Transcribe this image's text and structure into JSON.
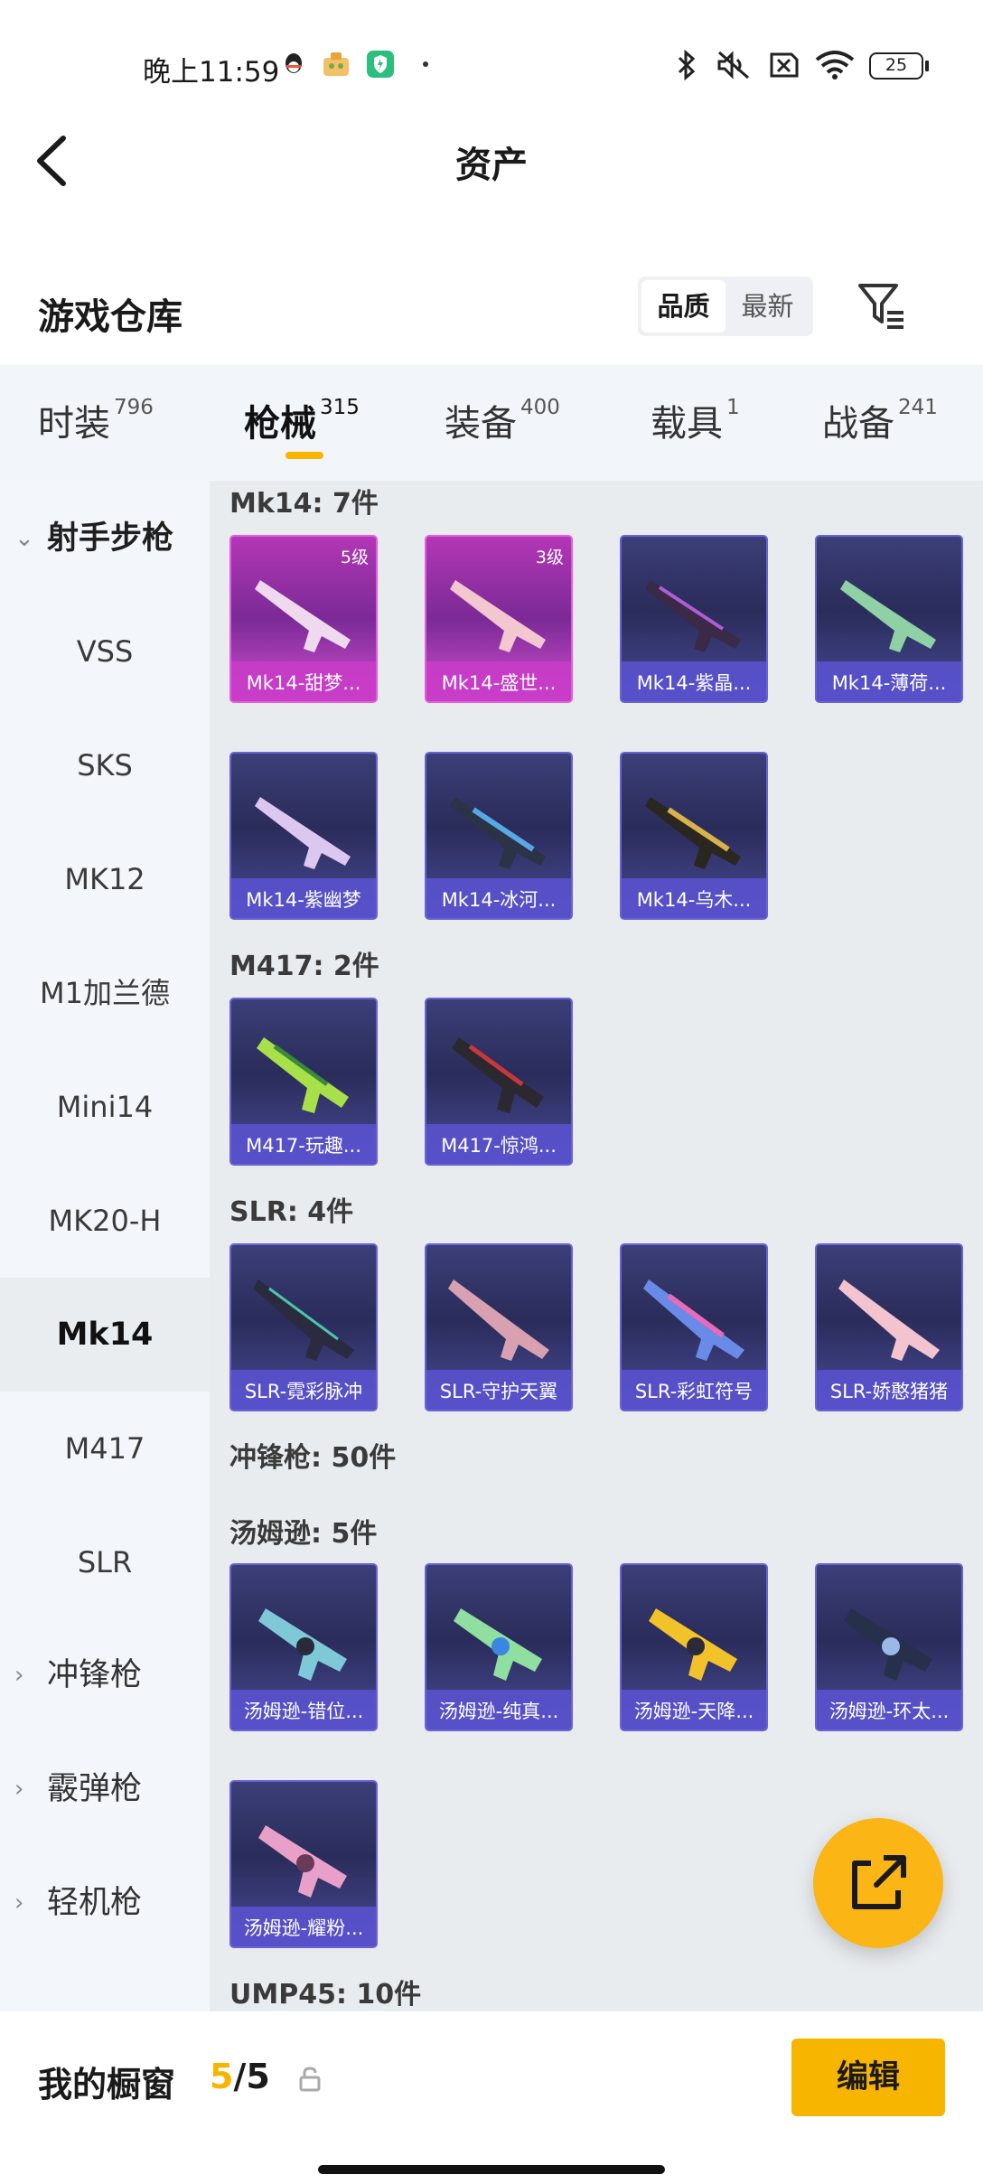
{
  "status_bar": {
    "time": "晚上11:59",
    "battery": "25",
    "icons": [
      "qq-icon",
      "app-icon",
      "security-icon",
      "bluetooth-icon",
      "mute-icon",
      "sim-icon",
      "wifi-icon"
    ]
  },
  "header": {
    "title": "资产",
    "back_icon": "chevron-left-icon"
  },
  "section": {
    "title": "游戏仓库",
    "sort": [
      "品质",
      "最新"
    ],
    "sort_active": "品质",
    "filter_icon": "filter-icon"
  },
  "tabs": [
    {
      "label": "时装",
      "count": "796"
    },
    {
      "label": "枪械",
      "count": "315"
    },
    {
      "label": "装备",
      "count": "400"
    },
    {
      "label": "载具",
      "count": "1"
    },
    {
      "label": "战备",
      "count": "241"
    }
  ],
  "active_tab": "枪械",
  "sidebar": {
    "group_expanded": "射手步枪",
    "items": [
      "VSS",
      "SKS",
      "MK12",
      "M1加兰德",
      "Mini14",
      "MK20-H",
      "Mk14",
      "M417",
      "SLR"
    ],
    "selected": "Mk14",
    "collapsed_groups": [
      "冲锋枪",
      "霰弹枪",
      "轻机枪"
    ]
  },
  "groups": [
    {
      "title": "Mk14: 7件",
      "items": [
        {
          "name": "Mk14-甜梦...",
          "level": "5级",
          "rarity": "pink"
        },
        {
          "name": "Mk14-盛世...",
          "level": "3级",
          "rarity": "pink"
        },
        {
          "name": "Mk14-紫晶...",
          "level": "",
          "rarity": "purple"
        },
        {
          "name": "Mk14-薄荷...",
          "level": "",
          "rarity": "purple"
        },
        {
          "name": "Mk14-紫幽梦",
          "level": "",
          "rarity": "purple"
        },
        {
          "name": "Mk14-冰河...",
          "level": "",
          "rarity": "purple"
        },
        {
          "name": "Mk14-乌木...",
          "level": "",
          "rarity": "purple"
        }
      ]
    },
    {
      "title": "M417: 2件",
      "items": [
        {
          "name": "M417-玩趣...",
          "level": "",
          "rarity": "purple"
        },
        {
          "name": "M417-惊鸿...",
          "level": "",
          "rarity": "purple"
        }
      ]
    },
    {
      "title": "SLR: 4件",
      "items": [
        {
          "name": "SLR-霓彩脉冲",
          "level": "",
          "rarity": "purple"
        },
        {
          "name": "SLR-守护天翼",
          "level": "",
          "rarity": "purple"
        },
        {
          "name": "SLR-彩虹符号",
          "level": "",
          "rarity": "purple"
        },
        {
          "name": "SLR-娇憨猪猪",
          "level": "",
          "rarity": "purple"
        }
      ]
    },
    {
      "title": "冲锋枪: 50件",
      "items": []
    },
    {
      "title": "汤姆逊: 5件",
      "items": [
        {
          "name": "汤姆逊-错位...",
          "level": "",
          "rarity": "purple"
        },
        {
          "name": "汤姆逊-纯真...",
          "level": "",
          "rarity": "purple"
        },
        {
          "name": "汤姆逊-天降...",
          "level": "",
          "rarity": "purple"
        },
        {
          "name": "汤姆逊-环太...",
          "level": "",
          "rarity": "purple"
        },
        {
          "name": "汤姆逊-耀粉...",
          "level": "",
          "rarity": "purple"
        }
      ]
    },
    {
      "title": "UMP45: 10件",
      "items": []
    }
  ],
  "bottom": {
    "label": "我的橱窗",
    "count_current": "5",
    "count_sep_total": "/5",
    "edit_label": "编辑"
  },
  "colors": {
    "accent": "#f7b500",
    "card_purple": "#3c3f78",
    "card_pink": "#b436b6"
  }
}
